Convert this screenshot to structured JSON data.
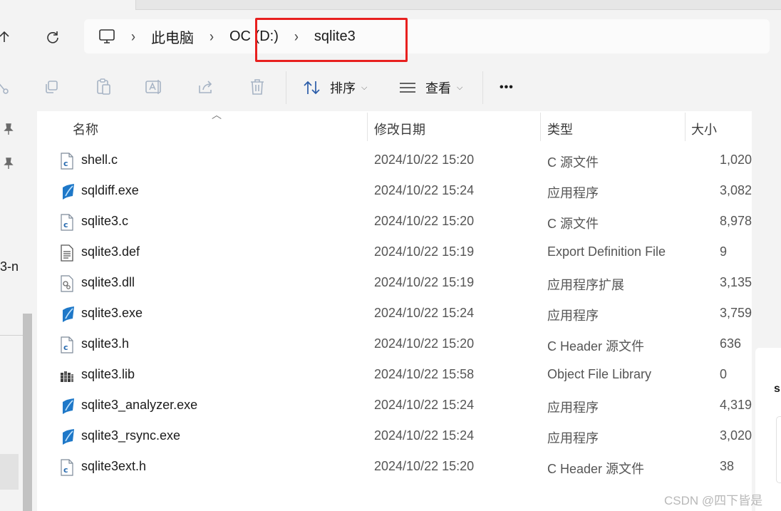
{
  "address": {
    "crumbs": [
      "此电脑",
      "OC (D:)",
      "sqlite3"
    ]
  },
  "toolbar": {
    "sort_label": "排序",
    "view_label": "查看",
    "more_label": "•••"
  },
  "left_pane": {
    "partial_text": "3-n"
  },
  "columns": {
    "name": "名称",
    "modified": "修改日期",
    "type": "类型",
    "size": "大小"
  },
  "files": [
    {
      "name": "shell.c",
      "date": "2024/10/22 15:20",
      "type": "C 源文件",
      "size": "1,020",
      "icon": "c-file-icon"
    },
    {
      "name": "sqldiff.exe",
      "date": "2024/10/22 15:24",
      "type": "应用程序",
      "size": "3,082",
      "icon": "exe-icon"
    },
    {
      "name": "sqlite3.c",
      "date": "2024/10/22 15:20",
      "type": "C 源文件",
      "size": "8,978",
      "icon": "c-file-icon"
    },
    {
      "name": "sqlite3.def",
      "date": "2024/10/22 15:19",
      "type": "Export Definition File",
      "size": "9",
      "icon": "text-file-icon"
    },
    {
      "name": "sqlite3.dll",
      "date": "2024/10/22 15:19",
      "type": "应用程序扩展",
      "size": "3,135",
      "icon": "dll-icon"
    },
    {
      "name": "sqlite3.exe",
      "date": "2024/10/22 15:24",
      "type": "应用程序",
      "size": "3,759",
      "icon": "exe-icon"
    },
    {
      "name": "sqlite3.h",
      "date": "2024/10/22 15:20",
      "type": "C Header 源文件",
      "size": "636",
      "icon": "c-file-icon"
    },
    {
      "name": "sqlite3.lib",
      "date": "2024/10/22 15:58",
      "type": "Object File Library",
      "size": "0",
      "icon": "lib-icon"
    },
    {
      "name": "sqlite3_analyzer.exe",
      "date": "2024/10/22 15:24",
      "type": "应用程序",
      "size": "4,319",
      "icon": "exe-icon"
    },
    {
      "name": "sqlite3_rsync.exe",
      "date": "2024/10/22 15:24",
      "type": "应用程序",
      "size": "3,020",
      "icon": "exe-icon"
    },
    {
      "name": "sqlite3ext.h",
      "date": "2024/10/22 15:20",
      "type": "C Header 源文件",
      "size": "38",
      "icon": "c-file-icon"
    }
  ],
  "right_pane": {
    "partial_text": "s"
  },
  "watermark": "CSDN @四下皆是",
  "colors": {
    "highlight_border": "#e8201f",
    "exe_icon_blue": "#1e78c8"
  }
}
